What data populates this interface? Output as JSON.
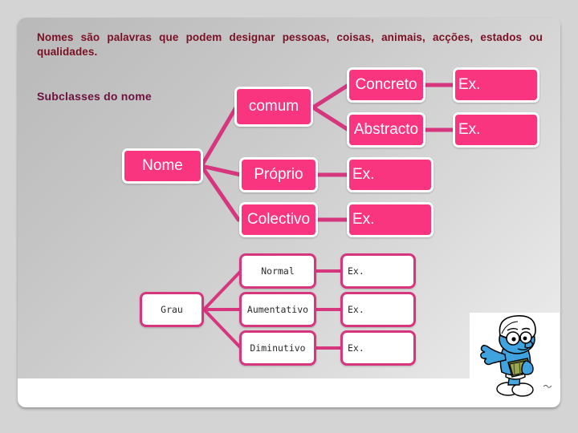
{
  "slide": {
    "intro_text": "Nomes  são palavras que podem designar pessoas, coisas, animais, acções, estados ou qualidades.",
    "subclasses_title": "Subclasses do nome"
  },
  "diagram": {
    "root": {
      "label": "Nome"
    },
    "branches": [
      {
        "label": "comum"
      },
      {
        "label": "Próprio"
      },
      {
        "label": "Colectivo"
      }
    ],
    "comum_children": [
      {
        "label": "Concreto"
      },
      {
        "label": "Abstracto"
      }
    ],
    "examples": {
      "concreto": "Ex.",
      "abstracto": "Ex.",
      "proprio": "Ex.",
      "colectivo": "Ex."
    }
  },
  "grau": {
    "root": {
      "label": "Grau"
    },
    "levels": [
      {
        "label": "Normal",
        "example": "Ex."
      },
      {
        "label": "Aumentativo",
        "example": "Ex."
      },
      {
        "label": "Diminutivo",
        "example": "Ex."
      }
    ]
  },
  "illustration": {
    "name": "brainy-smurf-with-book"
  },
  "colors": {
    "node_pink": "#F9357F",
    "node_border_white": "#FFFFFF",
    "connector_pink": "#D6367E",
    "heading_maroon": "#7A1023",
    "subtitle_magenta": "#6D1040",
    "panel_gray": "#CDCDCD"
  }
}
